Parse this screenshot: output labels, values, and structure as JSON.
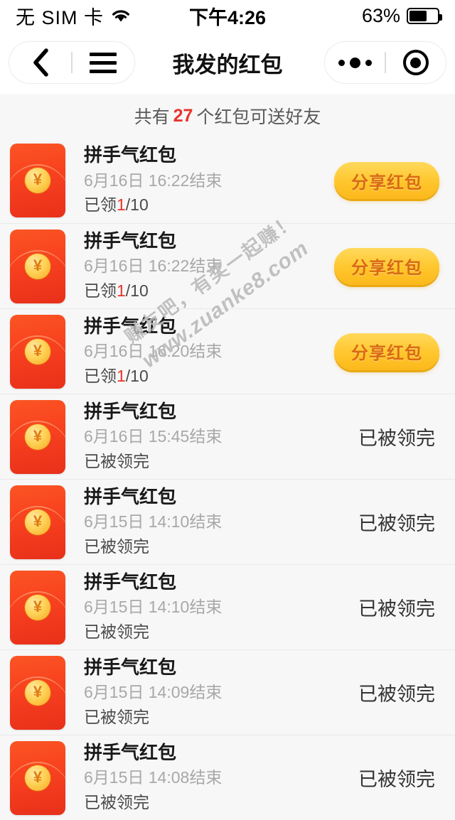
{
  "status_bar": {
    "carrier": "无 SIM 卡",
    "wifi_icon": "wifi-icon",
    "time": "下午4:26",
    "battery_percent": "63%",
    "battery_level": 63
  },
  "nav": {
    "back_icon": "back-chevron-icon",
    "menu_icon": "hamburger-menu-icon",
    "title": "我发的红包",
    "more_icon": "more-dots-icon",
    "capsule_icon": "target-circle-icon"
  },
  "subtitle": {
    "prefix": "共有",
    "count": "27",
    "suffix": "个红包可送好友"
  },
  "watermark": {
    "line1": "赚友吧，有奖一起赚！",
    "line2": "www.zuanke8.com"
  },
  "colors": {
    "accent_red": "#e8332a",
    "button_gold": "#ffc72e",
    "button_text": "#d96a12",
    "packet_red": "#f8421f",
    "background": "#f7f7f7"
  },
  "list": {
    "items": [
      {
        "icon": "red-packet-icon",
        "coin_symbol": "¥",
        "title": "拼手气红包",
        "date": "6月16日  16:22结束",
        "status_prefix": "已领",
        "status_num": "1",
        "status_suffix": "/10",
        "action_type": "button",
        "action_label": "分享红包"
      },
      {
        "icon": "red-packet-icon",
        "coin_symbol": "¥",
        "title": "拼手气红包",
        "date": "6月16日  16:22结束",
        "status_prefix": "已领",
        "status_num": "1",
        "status_suffix": "/10",
        "action_type": "button",
        "action_label": "分享红包"
      },
      {
        "icon": "red-packet-icon",
        "coin_symbol": "¥",
        "title": "拼手气红包",
        "date": "6月16日  16:20结束",
        "status_prefix": "已领",
        "status_num": "1",
        "status_suffix": "/10",
        "action_type": "button",
        "action_label": "分享红包"
      },
      {
        "icon": "red-packet-icon",
        "coin_symbol": "¥",
        "title": "拼手气红包",
        "date": "6月16日  15:45结束",
        "status_prefix": "已被领完",
        "status_num": "",
        "status_suffix": "",
        "action_type": "text",
        "action_label": "已被领完"
      },
      {
        "icon": "red-packet-icon",
        "coin_symbol": "¥",
        "title": "拼手气红包",
        "date": "6月15日  14:10结束",
        "status_prefix": "已被领完",
        "status_num": "",
        "status_suffix": "",
        "action_type": "text",
        "action_label": "已被领完"
      },
      {
        "icon": "red-packet-icon",
        "coin_symbol": "¥",
        "title": "拼手气红包",
        "date": "6月15日  14:10结束",
        "status_prefix": "已被领完",
        "status_num": "",
        "status_suffix": "",
        "action_type": "text",
        "action_label": "已被领完"
      },
      {
        "icon": "red-packet-icon",
        "coin_symbol": "¥",
        "title": "拼手气红包",
        "date": "6月15日  14:09结束",
        "status_prefix": "已被领完",
        "status_num": "",
        "status_suffix": "",
        "action_type": "text",
        "action_label": "已被领完"
      },
      {
        "icon": "red-packet-icon",
        "coin_symbol": "¥",
        "title": "拼手气红包",
        "date": "6月15日  14:08结束",
        "status_prefix": "已被领完",
        "status_num": "",
        "status_suffix": "",
        "action_type": "text",
        "action_label": "已被领完"
      }
    ]
  }
}
